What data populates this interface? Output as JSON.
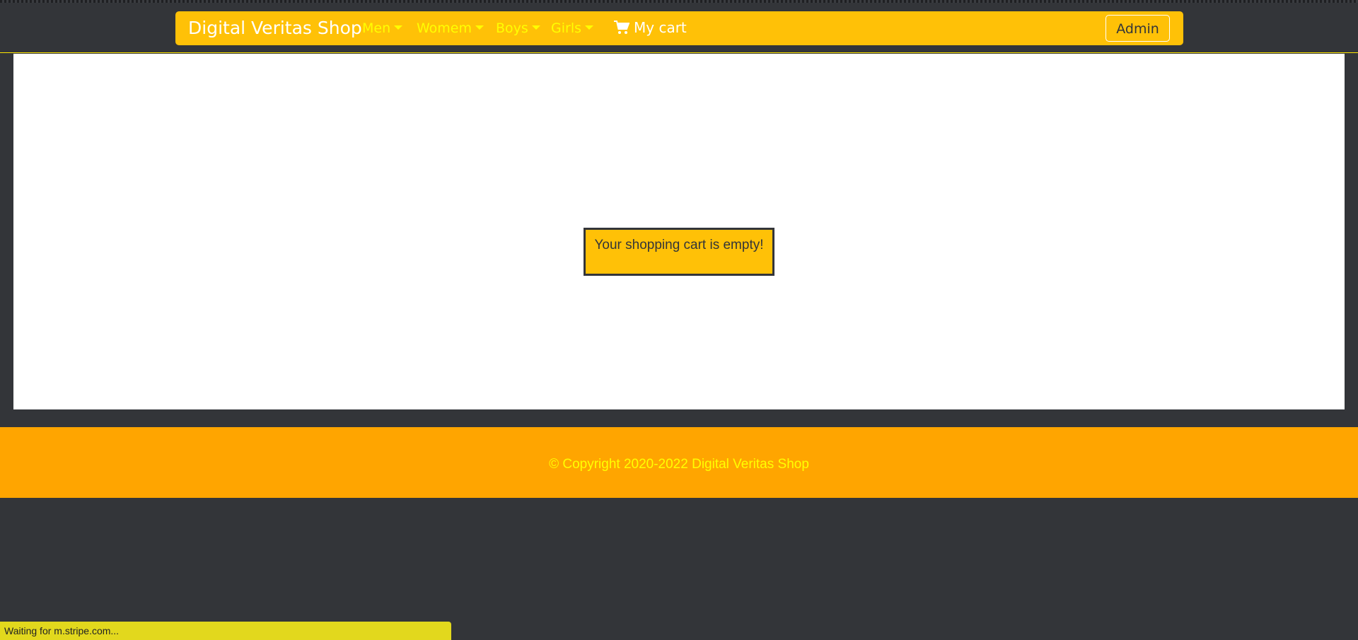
{
  "navbar": {
    "brand": "Digital Veritas Shop",
    "items": [
      {
        "label": "Men"
      },
      {
        "label": "Womem"
      },
      {
        "label": "Boys"
      },
      {
        "label": "Girls"
      }
    ],
    "cart": {
      "label": "My cart",
      "icon": "shopping-cart-icon"
    },
    "admin_label": "Admin"
  },
  "main": {
    "empty_message": "Your shopping cart is empty!"
  },
  "footer": {
    "copyright": "© Copyright 2020-2022 Digital Veritas Shop"
  },
  "status_bar": {
    "text": "Waiting for m.stripe.com..."
  },
  "colors": {
    "navbar_bg": "#ffc107",
    "nav_link": "#ffff00",
    "page_bg": "#333539",
    "footer_bg": "#ffa500",
    "status_bg": "#e2d81d"
  }
}
